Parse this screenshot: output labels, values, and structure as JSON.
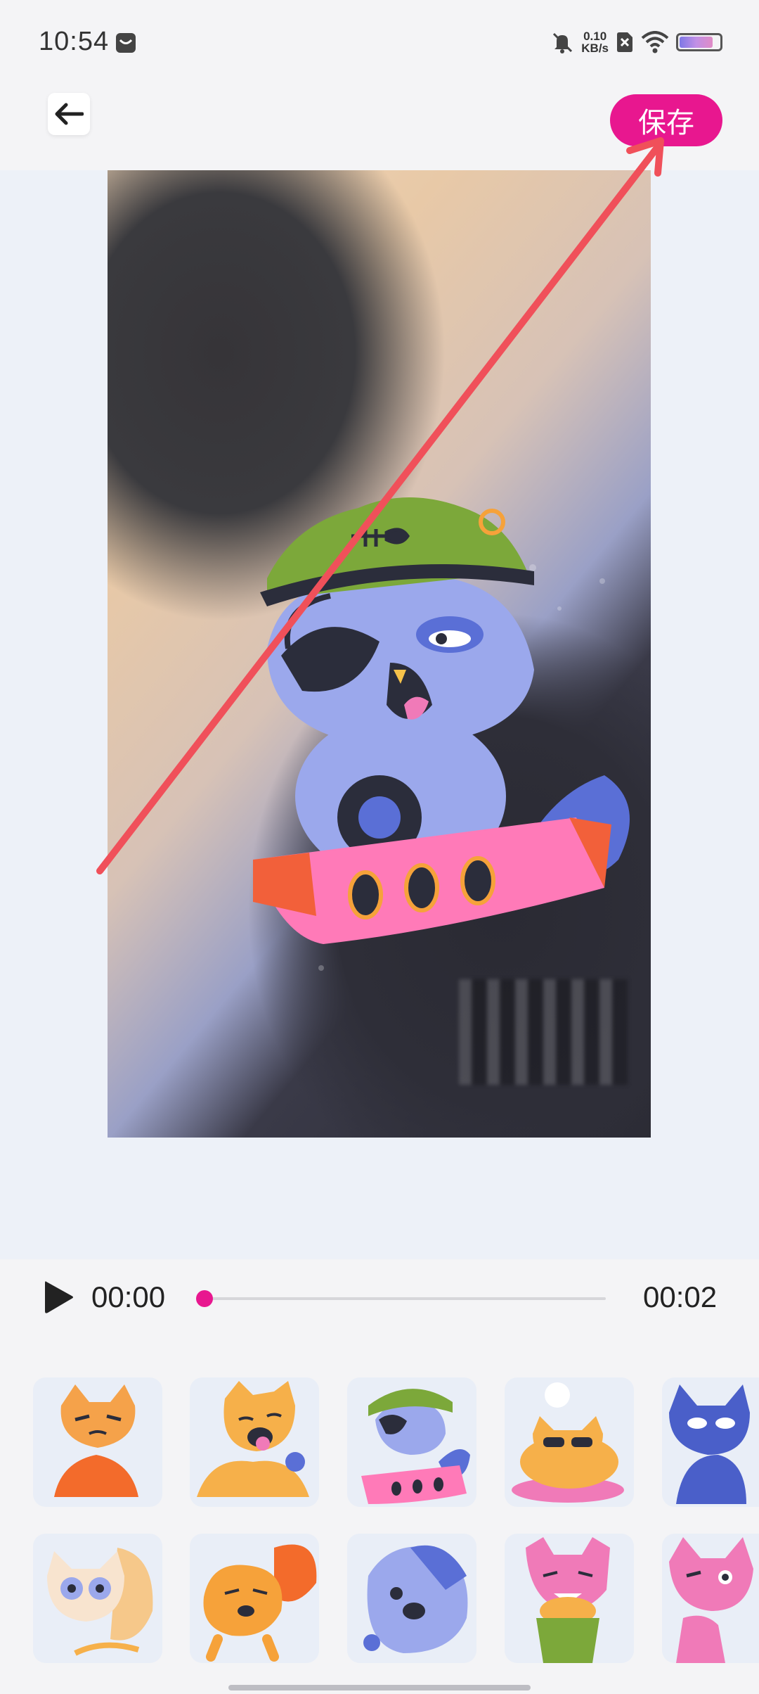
{
  "status_bar": {
    "time": "10:54",
    "net_speed_value": "0.10",
    "net_speed_unit": "KB/s",
    "battery_level": 0.85,
    "icons": [
      "message-icon",
      "mute-icon",
      "no-sim-icon",
      "wifi-icon",
      "battery-icon"
    ]
  },
  "header": {
    "back_icon": "arrow-left-icon",
    "save_label": "保存"
  },
  "player": {
    "current_time": "00:00",
    "total_time": "00:02",
    "progress": 0.0,
    "accent": "#e8178f"
  },
  "stickers": {
    "rows": [
      [
        "orange-cat-grumpy",
        "orange-cat-tongue",
        "pirate-cat-boat",
        "orange-cat-sunglasses",
        "blue-cat-sitting"
      ],
      [
        "cream-cat-glasses",
        "orange-cat-running",
        "blue-cat-lying",
        "pink-cat-in-pot",
        "pink-cat-winking"
      ]
    ]
  },
  "colors": {
    "accent": "#e8178f",
    "canvas_bg": "#edf1f8",
    "app_bg": "#f4f4f6",
    "annotation_arrow": "#f0505a"
  }
}
